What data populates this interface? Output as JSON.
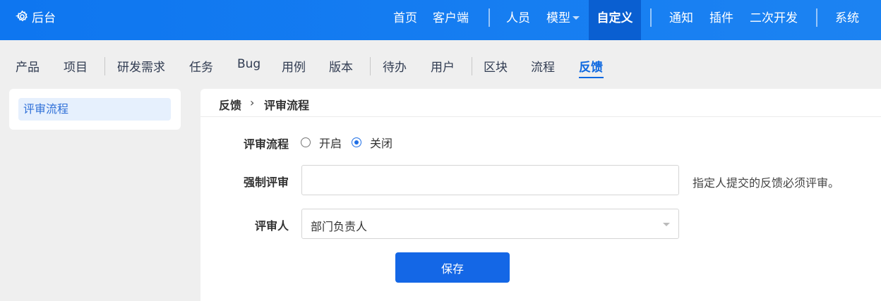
{
  "header": {
    "brand_label": "后台",
    "nav": {
      "home": "首页",
      "client": "客户端",
      "people": "人员",
      "model": "模型",
      "custom": "自定义",
      "notify": "通知",
      "plugin": "插件",
      "secondary_dev": "二次开发",
      "system": "系统"
    }
  },
  "subnav": {
    "items": [
      "产品",
      "项目",
      "研发需求",
      "任务",
      "Bug",
      "用例",
      "版本",
      "待办",
      "用户",
      "区块",
      "流程",
      "反馈"
    ],
    "current": "反馈"
  },
  "sidebar": {
    "items": [
      {
        "label": "评审流程",
        "selected": true
      }
    ]
  },
  "breadcrumb": {
    "parent": "反馈",
    "separator": "›",
    "current": "评审流程"
  },
  "form": {
    "review_flow": {
      "label": "评审流程",
      "options": [
        {
          "label": "开启",
          "checked": false
        },
        {
          "label": "关闭",
          "checked": true
        }
      ]
    },
    "force_review": {
      "label": "强制评审",
      "value": "",
      "hint": "指定人提交的反馈必须评审。"
    },
    "reviewer": {
      "label": "评审人",
      "selected": "部门负责人"
    },
    "save_label": "保存"
  },
  "colors": {
    "header_blue": "#0e76f0",
    "active_tab": "#0a5fd1",
    "accent": "#1467e6",
    "page_bg": "#efefef"
  }
}
